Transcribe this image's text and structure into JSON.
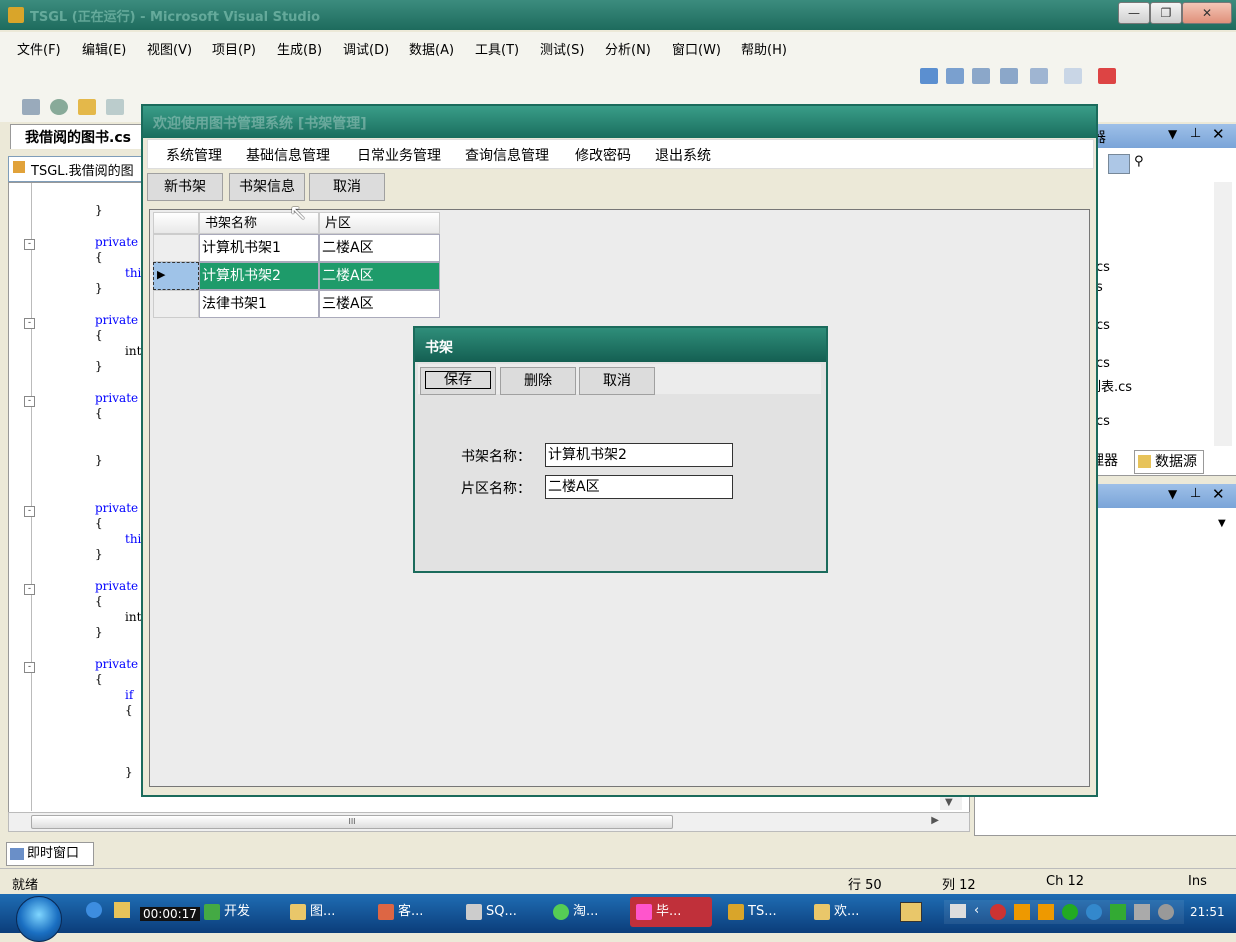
{
  "vs": {
    "title": "TSGL (正在运行) - Microsoft Visual Studio",
    "menu": [
      "文件(F)",
      "编辑(E)",
      "视图(V)",
      "项目(P)",
      "生成(B)",
      "调试(D)",
      "数据(A)",
      "工具(T)",
      "测试(S)",
      "分析(N)",
      "窗口(W)",
      "帮助(H)"
    ],
    "editor_tab": "我借阅的图书.cs",
    "editor_combo": "TSGL.我借阅的图",
    "code": [
      "}",
      "private",
      "{",
      "thi",
      "}",
      "private",
      "{",
      "int",
      "}",
      "private",
      "{",
      "}",
      "private",
      "{",
      "thi",
      "}",
      "private",
      "{",
      "int",
      "}",
      "private",
      "{",
      "if",
      "{",
      "}"
    ],
    "hscroll_label": "III",
    "right_panel1": {
      "title_partial": "器",
      "files": [
        "cs",
        "s",
        "cs",
        "cs",
        "列表.cs",
        "cs"
      ],
      "tab1": "理器",
      "tab2": "数据源"
    },
    "immediate_tab": "即时窗口",
    "status": {
      "left": "就绪",
      "row": "行 50",
      "col": "列 12",
      "ch": "Ch 12",
      "mode": "Ins"
    }
  },
  "taskbar": {
    "timer": "00:00:17",
    "tasks": [
      "开发",
      "图...",
      "客...",
      "SQ...",
      "淘...",
      "毕...",
      "TS...",
      "欢..."
    ],
    "clock": "21:51"
  },
  "app": {
    "title": "欢迎使用图书管理系统 [书架管理]",
    "menu": [
      "系统管理",
      "基础信息管理",
      "日常业务管理",
      "查询信息管理",
      "修改密码",
      "退出系统"
    ],
    "toolbar": [
      "新书架",
      "书架信息",
      "取消"
    ],
    "grid": {
      "headers": [
        "书架名称",
        "片区"
      ],
      "rows": [
        {
          "name": "计算机书架1",
          "area": "二楼A区"
        },
        {
          "name": "计算机书架2",
          "area": "二楼A区"
        },
        {
          "name": "法律书架1",
          "area": "三楼A区"
        }
      ]
    }
  },
  "dialog": {
    "title": "书架",
    "buttons": [
      "保存",
      "删除",
      "取消"
    ],
    "fields": [
      {
        "label": "书架名称：",
        "value": "计算机书架2"
      },
      {
        "label": "片区名称：",
        "value": "二楼A区"
      }
    ]
  }
}
